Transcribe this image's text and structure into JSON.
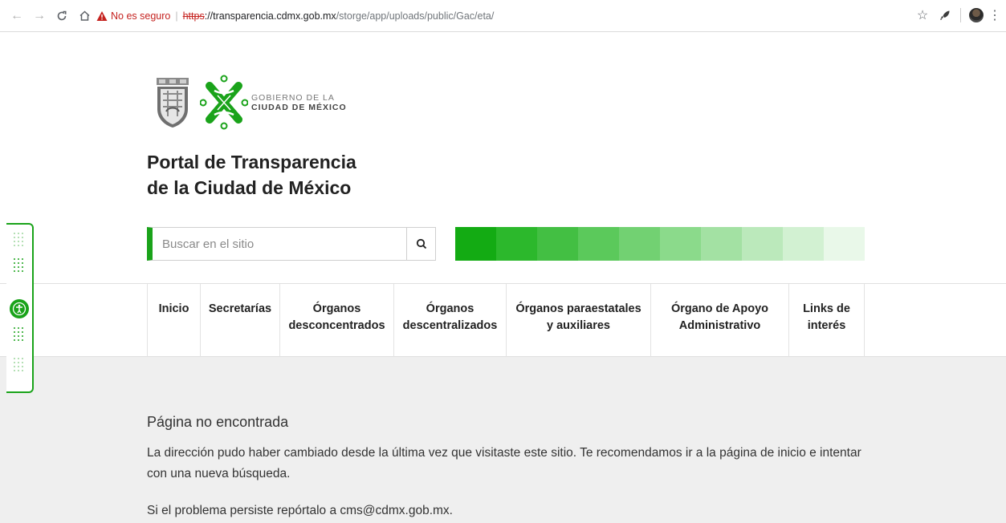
{
  "browser": {
    "security_label": "No es seguro",
    "url_scheme": "https",
    "url_host": "://transparencia.cdmx.gob.mx",
    "url_path": "/storge/app/uploads/public/Gac/eta/"
  },
  "header": {
    "gov_line1": "GOBIERNO DE LA",
    "gov_line2": "CIUDAD DE MÉXICO",
    "title_line1": "Portal de Transparencia",
    "title_line2": "de la Ciudad de México"
  },
  "search": {
    "placeholder": "Buscar en el sitio"
  },
  "palette": [
    "#13ab13",
    "#2cb82c",
    "#43bf43",
    "#5bc95b",
    "#72d172",
    "#8bda8b",
    "#a3e1a3",
    "#bbe9bb",
    "#d2f1d2",
    "#e9f8e9"
  ],
  "nav": {
    "items": [
      {
        "label": "Inicio"
      },
      {
        "label": "Secretarías"
      },
      {
        "line1": "Órganos",
        "line2": "desconcentrados"
      },
      {
        "line1": "Órganos",
        "line2": "descentralizados"
      },
      {
        "line1": "Órganos paraestatales",
        "line2": "y auxiliares"
      },
      {
        "line1": "Órgano de Apoyo",
        "line2": "Administrativo"
      },
      {
        "line1": "Links de",
        "line2": "interés"
      }
    ]
  },
  "main": {
    "title": "Página no encontrada",
    "body": "La dirección pudo haber cambiado desde la última vez que visitaste este sitio. Te recomendamos ir a la página de inicio e intentar con una nueva búsqueda.",
    "report": "Si el problema persiste repórtalo a cms@cdmx.gob.mx."
  },
  "brand_color": "#1aa31a"
}
